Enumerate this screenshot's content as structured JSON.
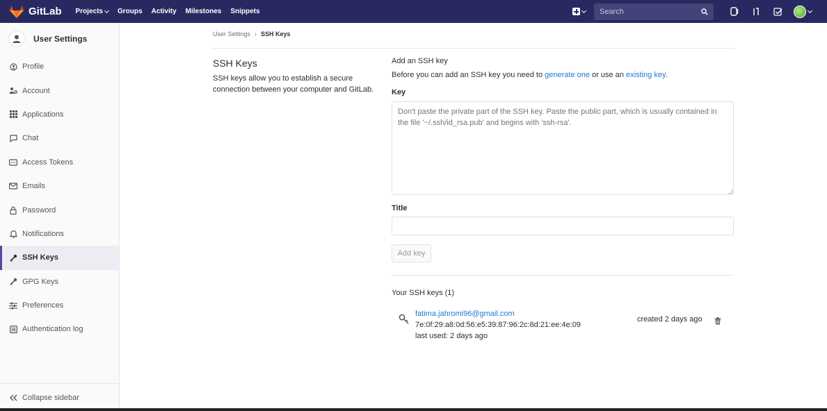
{
  "app": {
    "brand": "GitLab"
  },
  "nav": {
    "links": [
      {
        "label": "Projects",
        "has_caret": true
      },
      {
        "label": "Groups"
      },
      {
        "label": "Activity"
      },
      {
        "label": "Milestones"
      },
      {
        "label": "Snippets"
      }
    ],
    "search_placeholder": "Search"
  },
  "sidebar": {
    "title": "User Settings",
    "items": [
      {
        "label": "Profile",
        "icon": "profile-icon"
      },
      {
        "label": "Account",
        "icon": "account-icon"
      },
      {
        "label": "Applications",
        "icon": "applications-icon"
      },
      {
        "label": "Chat",
        "icon": "chat-icon"
      },
      {
        "label": "Access Tokens",
        "icon": "token-icon"
      },
      {
        "label": "Emails",
        "icon": "email-icon"
      },
      {
        "label": "Password",
        "icon": "lock-icon"
      },
      {
        "label": "Notifications",
        "icon": "bell-icon"
      },
      {
        "label": "SSH Keys",
        "icon": "key-icon",
        "active": true
      },
      {
        "label": "GPG Keys",
        "icon": "key-icon"
      },
      {
        "label": "Preferences",
        "icon": "sliders-icon"
      },
      {
        "label": "Authentication log",
        "icon": "log-icon"
      }
    ],
    "collapse_label": "Collapse sidebar"
  },
  "breadcrumb": {
    "parent": "User Settings",
    "current": "SSH Keys"
  },
  "intro": {
    "title": "SSH Keys",
    "description": "SSH keys allow you to establish a secure connection between your computer and GitLab."
  },
  "form": {
    "heading": "Add an SSH key",
    "desc_prefix": "Before you can add an SSH key you need to ",
    "desc_link1": "generate one",
    "desc_mid": " or use an ",
    "desc_link2": "existing key",
    "desc_suffix": ".",
    "key_label": "Key",
    "key_placeholder": "Don't paste the private part of the SSH key. Paste the public part, which is usually contained in the file '~/.ssh/id_rsa.pub' and begins with 'ssh-rsa'.",
    "title_label": "Title",
    "title_value": "",
    "submit_label": "Add key"
  },
  "keys": {
    "heading": "Your SSH keys (1)",
    "list": [
      {
        "title": "fatima.jahromi96@gmail.com",
        "fingerprint": "7e:0f:29:a8:0d:56:e5:39:87:96:2c:8d:21:ee:4e:09",
        "last_used": "last used: 2 days ago",
        "created": "created 2 days ago"
      }
    ]
  },
  "colors": {
    "nav_bg": "#292961",
    "link": "#1f78d1",
    "active_bar": "#4b4ba3"
  }
}
